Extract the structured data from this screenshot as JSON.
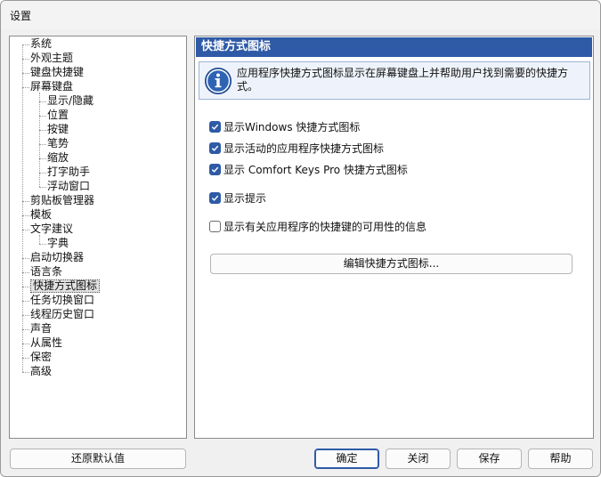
{
  "window": {
    "title": "设置"
  },
  "tree": {
    "items": [
      {
        "label": "系统",
        "level": 0
      },
      {
        "label": "外观主题",
        "level": 0
      },
      {
        "label": "键盘快捷键",
        "level": 0
      },
      {
        "label": "屏幕键盘",
        "level": 0
      },
      {
        "label": "显示/隐藏",
        "level": 1
      },
      {
        "label": "位置",
        "level": 1
      },
      {
        "label": "按键",
        "level": 1
      },
      {
        "label": "笔势",
        "level": 1
      },
      {
        "label": "缩放",
        "level": 1
      },
      {
        "label": "打字助手",
        "level": 1
      },
      {
        "label": "浮动窗口",
        "level": 1
      },
      {
        "label": "剪贴板管理器",
        "level": 0
      },
      {
        "label": "模板",
        "level": 0
      },
      {
        "label": "文字建议",
        "level": 0
      },
      {
        "label": "字典",
        "level": 1
      },
      {
        "label": "启动切换器",
        "level": 0
      },
      {
        "label": "语言条",
        "level": 0
      },
      {
        "label": "快捷方式图标",
        "level": 0,
        "selected": true
      },
      {
        "label": "任务切换窗口",
        "level": 0
      },
      {
        "label": "线程历史窗口",
        "level": 0
      },
      {
        "label": "声音",
        "level": 0
      },
      {
        "label": "从属性",
        "level": 0
      },
      {
        "label": "保密",
        "level": 0
      },
      {
        "label": "高级",
        "level": 0
      }
    ]
  },
  "panel": {
    "header": "快捷方式图标",
    "info_text": "应用程序快捷方式图标显示在屏幕键盘上并帮助用户找到需要的快捷方式。",
    "options": [
      {
        "label": "显示Windows 快捷方式图标",
        "checked": true
      },
      {
        "label": "显示活动的应用程序快捷方式图标",
        "checked": true
      },
      {
        "label": "显示 Comfort Keys Pro 快捷方式图标",
        "checked": true
      },
      {
        "label": "显示提示",
        "checked": true
      },
      {
        "label": "显示有关应用程序的快捷键的可用性的信息",
        "checked": false
      }
    ],
    "edit_button": "编辑快捷方式图标..."
  },
  "buttons": {
    "restore_defaults": "还原默认值",
    "ok": "确定",
    "close": "关闭",
    "save": "保存",
    "help": "帮助"
  },
  "colors": {
    "accent": "#2e5aa6",
    "info_bg": "#eef3fb"
  }
}
